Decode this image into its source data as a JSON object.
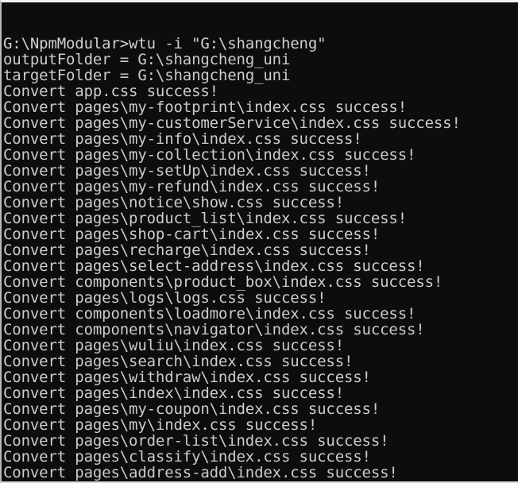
{
  "window": {
    "type": "windows-command-prompt",
    "background_color": "#0d0d0d",
    "text_color": "#cccccc",
    "frame_top_color": "#f2f2f2",
    "frame_left_color": "#b9b9b9",
    "frame_accent_color": "#1d8f8f"
  },
  "console": {
    "prompt": "G:\\NpmModular>",
    "command": "wtu -i \"G:\\shangcheng\"",
    "lines": [
      "G:\\NpmModular>wtu -i \"G:\\shangcheng\"",
      "outputFolder = G:\\shangcheng_uni",
      "targetFolder = G:\\shangcheng_uni",
      "Convert app.css success!",
      "Convert pages\\my-footprint\\index.css success!",
      "Convert pages\\my-customerService\\index.css success!",
      "Convert pages\\my-info\\index.css success!",
      "Convert pages\\my-collection\\index.css success!",
      "Convert pages\\my-setUp\\index.css success!",
      "Convert pages\\my-refund\\index.css success!",
      "Convert pages\\notice\\show.css success!",
      "Convert pages\\product_list\\index.css success!",
      "Convert pages\\shop-cart\\index.css success!",
      "Convert pages\\recharge\\index.css success!",
      "Convert pages\\select-address\\index.css success!",
      "Convert components\\product_box\\index.css success!",
      "Convert pages\\logs\\logs.css success!",
      "Convert components\\loadmore\\index.css success!",
      "Convert components\\navigator\\index.css success!",
      "Convert pages\\wuliu\\index.css success!",
      "Convert pages\\search\\index.css success!",
      "Convert pages\\withdraw\\index.css success!",
      "Convert pages\\index\\index.css success!",
      "Convert pages\\my-coupon\\index.css success!",
      "Convert pages\\my\\index.css success!",
      "Convert pages\\order-list\\index.css success!",
      "Convert pages\\classify\\index.css success!",
      "Convert pages\\address-add\\index.css success!"
    ]
  }
}
